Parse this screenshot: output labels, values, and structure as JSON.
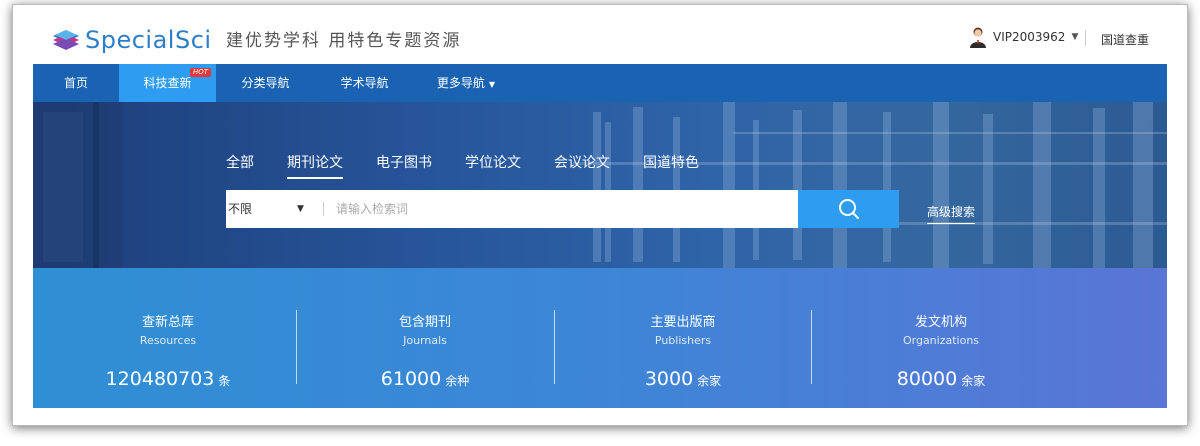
{
  "header": {
    "logo_text": "SpecialSci",
    "slogan": "建优势学科 用特色专题资源",
    "user": "VIP2003962",
    "link": "国道查重"
  },
  "nav": [
    {
      "label": "首页",
      "active": false
    },
    {
      "label": "科技查新",
      "active": true,
      "badge": "HOT"
    },
    {
      "label": "分类导航",
      "active": false
    },
    {
      "label": "学术导航",
      "active": false
    },
    {
      "label": "更多导航",
      "active": false,
      "dropdown": true
    }
  ],
  "search": {
    "tabs": [
      "全部",
      "期刊论文",
      "电子图书",
      "学位论文",
      "会议论文",
      "国道特色"
    ],
    "active_tab": "期刊论文",
    "scope": "不限",
    "placeholder": "请输入检索词",
    "advanced": "高级搜索",
    "button_icon": "search-icon"
  },
  "stats": [
    {
      "title": "查新总库",
      "subtitle": "Resources",
      "value": "120480703",
      "unit": "条"
    },
    {
      "title": "包含期刊",
      "subtitle": "Journals",
      "value": "61000",
      "unit": "余种"
    },
    {
      "title": "主要出版商",
      "subtitle": "Publishers",
      "value": "3000",
      "unit": "余家"
    },
    {
      "title": "发文机构",
      "subtitle": "Organizations",
      "value": "80000",
      "unit": "余家"
    }
  ],
  "colors": {
    "nav": "#1a63b2",
    "accent": "#2e9cf0",
    "hot": "#e23a3a"
  }
}
